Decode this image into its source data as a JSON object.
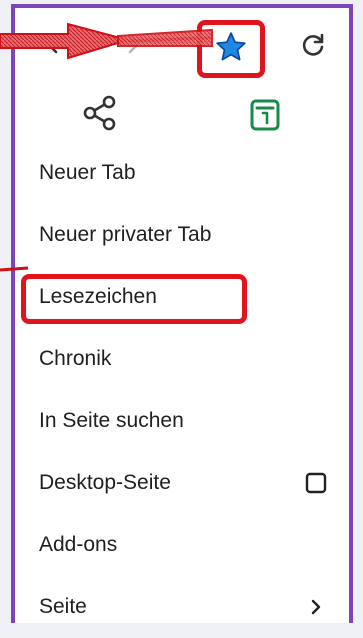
{
  "toolbar": {
    "back_icon": "arrow-back-icon",
    "forward_icon": "arrow-forward-icon",
    "bookmark_icon": "star-icon",
    "reload_icon": "reload-icon"
  },
  "actions": {
    "share_icon": "share-icon",
    "reader_icon": "reader-view-icon"
  },
  "menu": {
    "items": [
      {
        "label": "Neuer Tab"
      },
      {
        "label": "Neuer privater Tab"
      },
      {
        "label": "Lesezeichen"
      },
      {
        "label": "Chronik"
      },
      {
        "label": "In Seite suchen"
      },
      {
        "label": "Desktop-Seite",
        "trailing": "checkbox-unchecked"
      },
      {
        "label": "Add-ons"
      },
      {
        "label": "Seite",
        "trailing": "chevron-right"
      }
    ]
  },
  "colors": {
    "border": "#7b46b8",
    "highlight": "#e0141c",
    "star": "#1e88e5",
    "reader": "#1a8a4a"
  }
}
